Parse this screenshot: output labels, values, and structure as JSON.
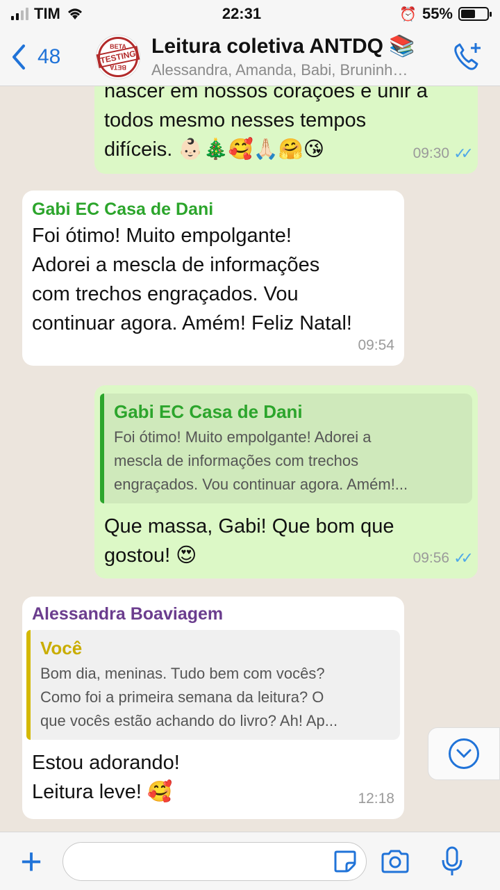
{
  "status": {
    "carrier": "TIM",
    "time": "22:31",
    "battery": "55%",
    "battery_level": 0.55
  },
  "header": {
    "back_count": "48",
    "group_name": "Leitura coletiva ANTDQ 📚",
    "members": "Alessandra, Amanda, Babi, Bruninh…",
    "avatar_text": {
      "top": "BETA",
      "mid": "TESTING",
      "bottom": "BETA"
    }
  },
  "messages": [
    {
      "type": "out",
      "text_lines": [
        "nascer em nossos corações e unir a",
        "todos mesmo nesses tempos",
        "difíceis. 👶🏻🎄🥰🙏🏻🤗😘"
      ],
      "time": "09:30"
    },
    {
      "type": "in",
      "sender": "Gabi EC Casa de Dani",
      "text_lines": [
        "Foi ótimo! Muito empolgante!",
        "Adorei a mescla de informações",
        "com trechos engraçados. Vou",
        "continuar agora. Amém! Feliz Natal!"
      ],
      "time": "09:54"
    },
    {
      "type": "out",
      "quote": {
        "name": "Gabi EC Casa de Dani",
        "lines": [
          "Foi ótimo! Muito empolgante! Adorei a",
          "mescla de informações com trechos",
          "engraçados. Vou continuar agora. Amém!..."
        ]
      },
      "text_lines": [
        "Que massa, Gabi! Que bom que",
        "gostou! 😍"
      ],
      "time": "09:56"
    },
    {
      "type": "in",
      "sender": "Alessandra Boaviagem",
      "quote": {
        "name": "Você",
        "lines": [
          "Bom dia, meninas. Tudo bem com vocês?",
          "Como foi a primeira semana da leitura? O",
          "que vocês estão achando do livro? Ah! Ap..."
        ]
      },
      "text_lines": [
        "Estou adorando!",
        "Leitura leve! 🥰"
      ],
      "time": "12:18"
    }
  ],
  "colors": {
    "accent": "#2073d8",
    "out_bubble": "#dcf8c6",
    "sender_gabi": "#2ca52c",
    "sender_alessandra": "#6b3d8e",
    "quote_you": "#d4b800"
  },
  "composer": {
    "placeholder": ""
  }
}
